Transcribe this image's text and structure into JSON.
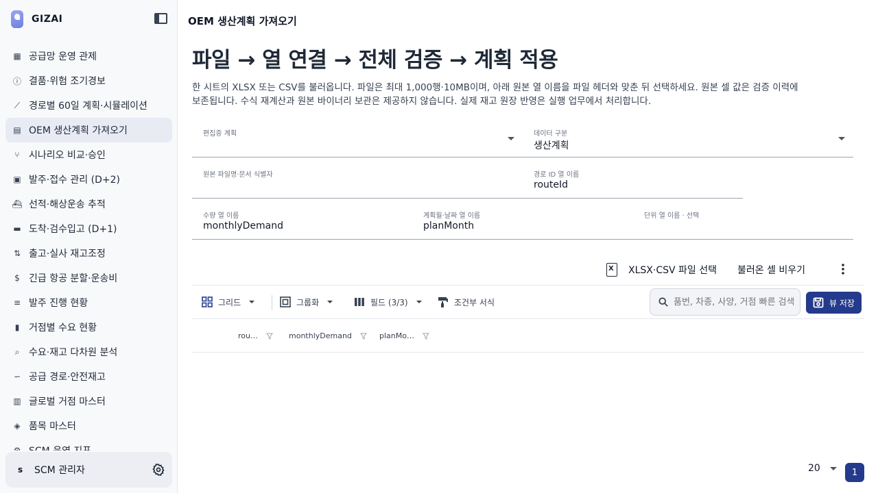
{
  "brand": {
    "name": "GIZAI"
  },
  "sidebar": {
    "items": [
      {
        "label": "공급망 운영 관제",
        "icon": "dashboard-icon"
      },
      {
        "label": "결품·위험 조기경보",
        "icon": "alert-circle-icon"
      },
      {
        "label": "경로별 60일 계획·시뮬레이션",
        "icon": "trend-icon"
      },
      {
        "label": "OEM 생산계획 가져오기",
        "icon": "file-import-icon",
        "active": true
      },
      {
        "label": "시나리오 비교·승인",
        "icon": "branch-icon"
      },
      {
        "label": "발주·접수 관리 (D+2)",
        "icon": "clipboard-icon"
      },
      {
        "label": "선적·해상운송 추적",
        "icon": "ship-icon"
      },
      {
        "label": "도착·검수입고 (D+1)",
        "icon": "archive-icon"
      },
      {
        "label": "출고·실사 재고조정",
        "icon": "swap-icon"
      },
      {
        "label": "긴급 항공 분할·운송비",
        "icon": "dollar-icon"
      },
      {
        "label": "발주 진행 현황",
        "icon": "checklist-icon"
      },
      {
        "label": "거점별 수요 현황",
        "icon": "bar-chart-icon"
      },
      {
        "label": "수요·재고 다차원 분석",
        "icon": "analysis-icon"
      },
      {
        "label": "공급 경로·안전재고",
        "icon": "route-icon"
      },
      {
        "label": "글로벌 거점 마스터",
        "icon": "building-icon"
      },
      {
        "label": "품목 마스터",
        "icon": "cube-icon"
      },
      {
        "label": "SCM 운영 지표",
        "icon": "settings-nodes-icon"
      }
    ]
  },
  "user": {
    "initial": "s",
    "name": "SCM 관리자"
  },
  "header": {
    "title": "OEM 생산계획 가져오기"
  },
  "hero": {
    "title": "파일 → 열 연결 → 전체 검증 → 계획 적용"
  },
  "description": "한 시트의 XLSX 또는 CSV를 불러옵니다. 파일은 최대 1,000행·10MB이며, 아래 원본 열 이름을 파일 헤더와 맞춘 뒤 선택하세요. 원본 셀 값은 검증 이력에 보존됩니다. 수식 재계산과 원본 바이너리 보관은 제공하지 않습니다. 실제 재고 원장 반영은 실행 업무에서 처리합니다.",
  "form": {
    "plan": {
      "label": "편집중 계획",
      "value": ""
    },
    "data_type": {
      "label": "데이터 구분",
      "value": "생산계획"
    },
    "source": {
      "label": "원본 파일명·문서 식별자",
      "value": ""
    },
    "route_col": {
      "label": "경로 ID 열 이름",
      "value": "routeId"
    },
    "qty_col": {
      "label": "수량 열 이름",
      "value": "monthlyDemand"
    },
    "date_col": {
      "label": "계획월·날짜 열 이름",
      "value": "planMonth"
    },
    "unit_col": {
      "label": "단위 열 이름 · 선택",
      "value": ""
    }
  },
  "actions": {
    "select_file": "XLSX·CSV 파일 선택",
    "clear_cells": "불러온 셀 비우기"
  },
  "toolbar": {
    "grid": "그리드",
    "group": "그룹화",
    "fields": "필드 (3/3)",
    "conditional": "조건부 서식",
    "search_placeholder": "품번, 차종, 사양, 거점 빠른 검색",
    "save": "뷰 저장"
  },
  "grid": {
    "columns": [
      "rou…",
      "monthlyDemand",
      "planMo…"
    ]
  },
  "pagination": {
    "page_size": "20",
    "current_page": "1"
  },
  "colors": {
    "accent": "#243a8c",
    "active_bg": "#e8ebf4"
  }
}
